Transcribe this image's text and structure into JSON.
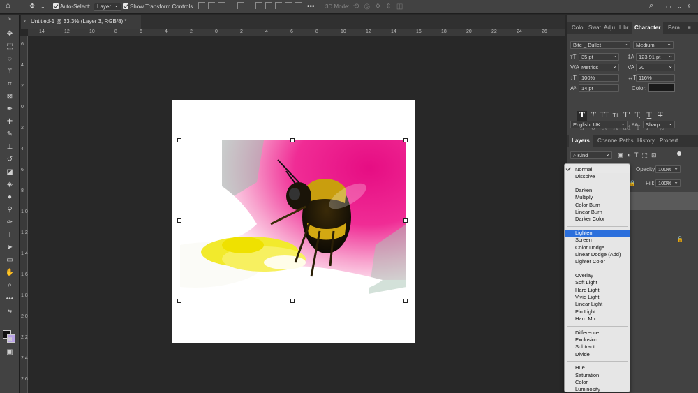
{
  "optionbar": {
    "auto_select_label": "Auto-Select:",
    "auto_select_value": "Layer",
    "transform_label": "Show Transform Controls",
    "mode_3d_label": "3D Mode:"
  },
  "document_tab": {
    "title": "Untitled-1 @ 33.3% (Layer 3, RGB/8) *",
    "close": "×"
  },
  "rulers": {
    "top": [
      "14",
      "12",
      "10",
      "8",
      "6",
      "4",
      "2",
      "0",
      "2",
      "4",
      "6",
      "8",
      "10",
      "12",
      "14",
      "16",
      "18",
      "20",
      "22",
      "24",
      "26",
      "28"
    ],
    "left": [
      "6",
      "4",
      "2",
      "0",
      "2",
      "4",
      "6",
      "8",
      "1 0",
      "1 2",
      "1 4",
      "1 6",
      "1 8",
      "2 0",
      "2 2",
      "2 4",
      "2 6"
    ]
  },
  "panels_top": {
    "tabs": [
      "Colo",
      "Swat",
      "Adju",
      "Libr",
      "Character",
      "Para"
    ],
    "active": "Character"
  },
  "character": {
    "font_family": "Bite _ Bullet",
    "font_style": "Medium",
    "font_size": "35 pt",
    "leading": "123.91 pt",
    "kerning": "Metrics",
    "tracking": "20",
    "vertical_scale": "100%",
    "horizontal_scale": "116%",
    "baseline_shift": "14 pt",
    "color_label": "Color:",
    "color_value": "#1a1a1a",
    "language": "English: UK",
    "aa_label": "aa",
    "antialias": "Sharp"
  },
  "panels_layers": {
    "tabs": [
      "Layers",
      "Channe",
      "Paths",
      "History",
      "Propert"
    ],
    "active": "Layers",
    "kind_label": "Kind",
    "opacity_label": "Opacity:",
    "opacity_value": "100%",
    "fill_label": "Fill:",
    "fill_value": "100%"
  },
  "blend_modes": {
    "current": "Lighten",
    "groups": [
      [
        "Normal",
        "Dissolve"
      ],
      [
        "Darken",
        "Multiply",
        "Color Burn",
        "Linear Burn",
        "Darker Color"
      ],
      [
        "Lighten",
        "Screen",
        "Color Dodge",
        "Linear Dodge (Add)",
        "Lighter Color"
      ],
      [
        "Overlay",
        "Soft Light",
        "Hard Light",
        "Vivid Light",
        "Linear Light",
        "Pin Light",
        "Hard Mix"
      ],
      [
        "Difference",
        "Exclusion",
        "Subtract",
        "Divide"
      ],
      [
        "Hue",
        "Saturation",
        "Color",
        "Luminosity"
      ]
    ],
    "checked": "Normal"
  },
  "colors": {
    "foreground": "#111111",
    "background": "#b9a3e6",
    "selection": "#2b6fdc"
  }
}
